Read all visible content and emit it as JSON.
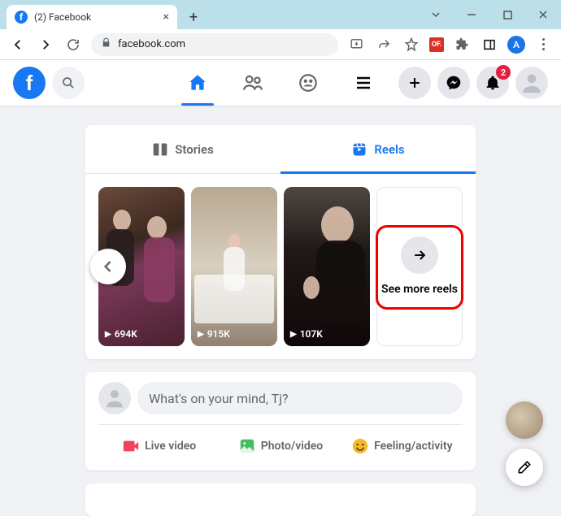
{
  "browser": {
    "tab_title": "(2) Facebook",
    "url": "facebook.com",
    "profile_letter": "A",
    "ext_label": "OF."
  },
  "fb": {
    "notification_count": "2"
  },
  "tabs": {
    "stories": "Stories",
    "reels": "Reels"
  },
  "reels": [
    {
      "views": "694K"
    },
    {
      "views": "915K"
    },
    {
      "views": "107K"
    }
  ],
  "see_more": "See more reels",
  "composer": {
    "placeholder": "What's on your mind, Tj?",
    "live": "Live video",
    "photo": "Photo/video",
    "feeling": "Feeling/activity"
  }
}
